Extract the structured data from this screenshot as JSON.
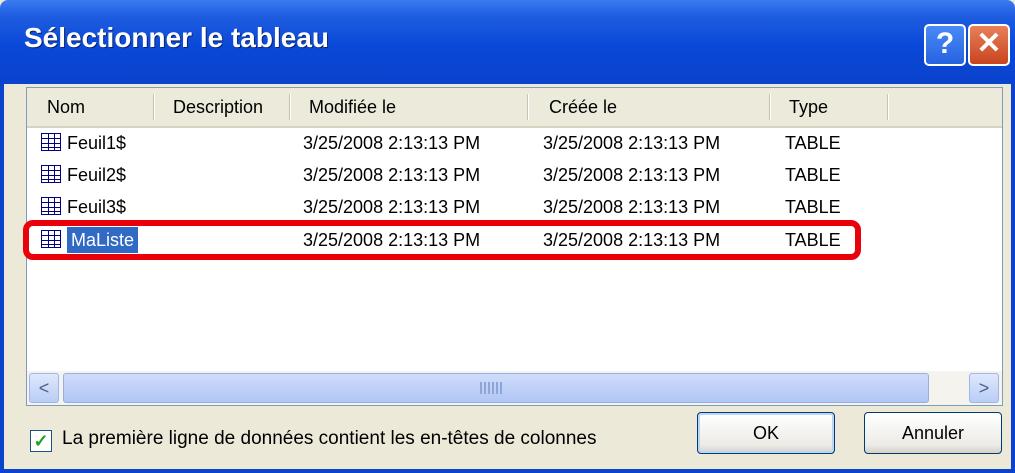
{
  "window": {
    "title": "Sélectionner le tableau",
    "help_glyph": "?",
    "close_glyph": "✕"
  },
  "columns": [
    "Nom",
    "Description",
    "Modifiée le",
    "Créée le",
    "Type"
  ],
  "rows": [
    {
      "name": "Feuil1$",
      "description": "",
      "modified": "3/25/2008 2:13:13 PM",
      "created": "3/25/2008 2:13:13 PM",
      "type": "TABLE",
      "selected": false
    },
    {
      "name": "Feuil2$",
      "description": "",
      "modified": "3/25/2008 2:13:13 PM",
      "created": "3/25/2008 2:13:13 PM",
      "type": "TABLE",
      "selected": false
    },
    {
      "name": "Feuil3$",
      "description": "",
      "modified": "3/25/2008 2:13:13 PM",
      "created": "3/25/2008 2:13:13 PM",
      "type": "TABLE",
      "selected": false
    },
    {
      "name": "MaListe",
      "description": "",
      "modified": "3/25/2008 2:13:13 PM",
      "created": "3/25/2008 2:13:13 PM",
      "type": "TABLE",
      "selected": true
    }
  ],
  "row_icon": "table-icon",
  "highlight_color": "#e8000a",
  "selection_color": "#316ac5",
  "scrollbar": {
    "left_arrow": "<",
    "right_arrow": ">"
  },
  "options": {
    "first_row_headers_label": "La première ligne de données contient les en-têtes de colonnes",
    "first_row_headers_checked": true,
    "check_glyph": "✓"
  },
  "buttons": {
    "ok": "OK",
    "cancel": "Annuler"
  }
}
